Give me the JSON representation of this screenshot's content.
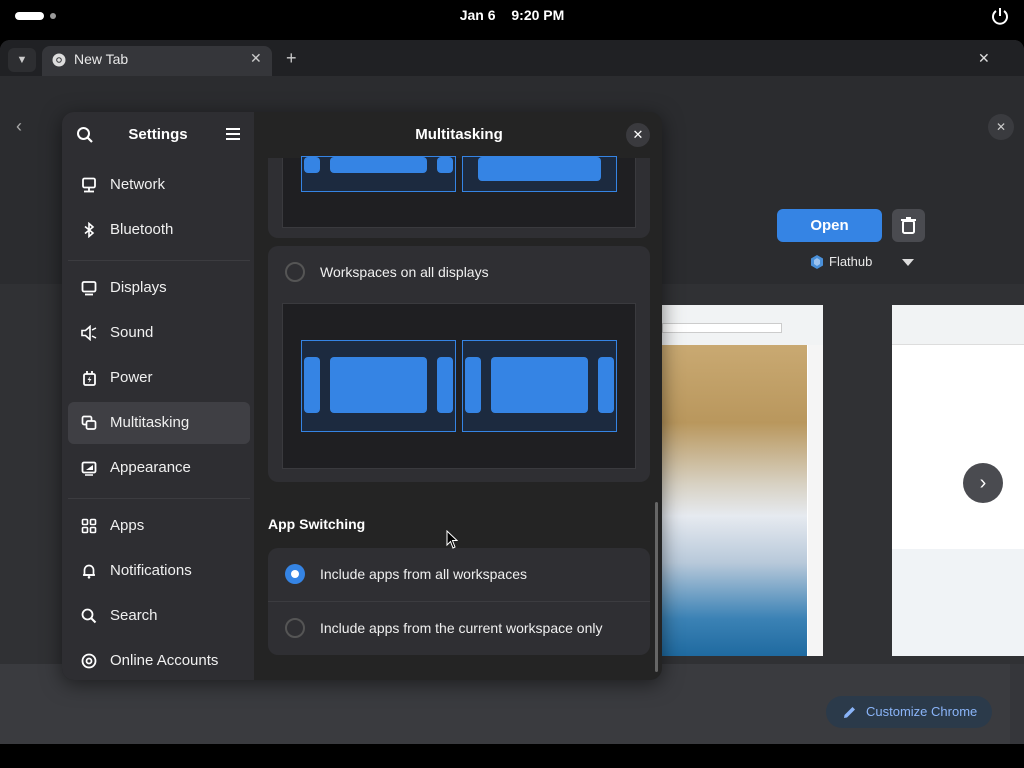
{
  "topbar": {
    "date": "Jan 6",
    "time": "9:20 PM"
  },
  "browser": {
    "tab_title": "New Tab",
    "store": {
      "open_label": "Open",
      "source_label": "Flathub"
    },
    "customize_label": "Customize Chrome"
  },
  "settings": {
    "title": "Settings",
    "sidebar": {
      "items": [
        {
          "label": "Network",
          "icon": "network-icon"
        },
        {
          "label": "Bluetooth",
          "icon": "bluetooth-icon"
        },
        {
          "label": "Displays",
          "icon": "display-icon"
        },
        {
          "label": "Sound",
          "icon": "sound-icon"
        },
        {
          "label": "Power",
          "icon": "power-icon"
        },
        {
          "label": "Multitasking",
          "icon": "multitasking-icon",
          "selected": true
        },
        {
          "label": "Appearance",
          "icon": "appearance-icon"
        },
        {
          "label": "Apps",
          "icon": "apps-icon"
        },
        {
          "label": "Notifications",
          "icon": "bell-icon"
        },
        {
          "label": "Search",
          "icon": "search-icon"
        },
        {
          "label": "Online Accounts",
          "icon": "at-icon"
        }
      ]
    },
    "panel": {
      "title": "Multitasking",
      "workspaces_all_displays": "Workspaces on all displays",
      "app_switching_heading": "App Switching",
      "app_switching_options": [
        {
          "label": "Include apps from all workspaces",
          "selected": true
        },
        {
          "label": "Include apps from the current workspace only",
          "selected": false
        }
      ]
    }
  },
  "colors": {
    "accent": "#3584e4",
    "sidebar_bg": "#2e2e32",
    "window_bg": "#242424"
  }
}
